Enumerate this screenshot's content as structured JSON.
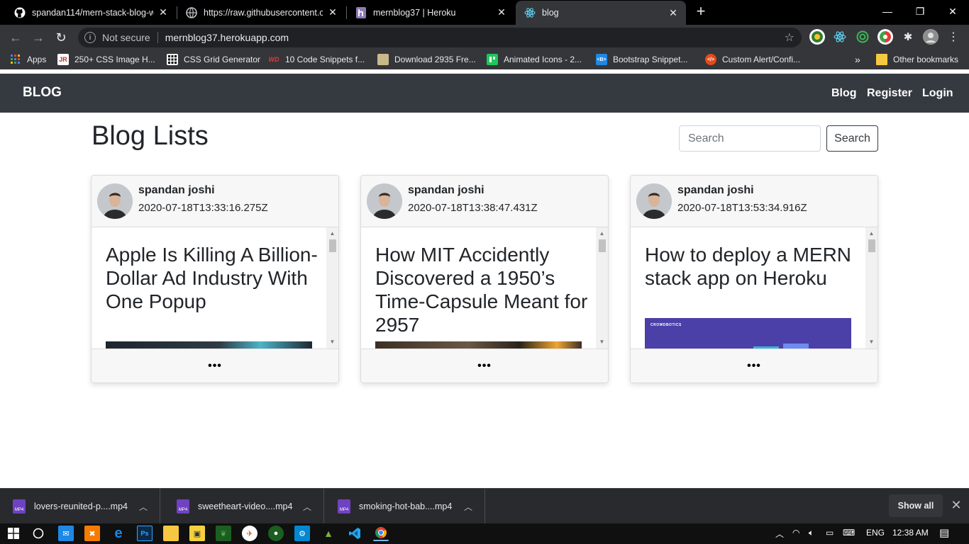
{
  "browser": {
    "tabs": [
      {
        "title": "spandan114/mern-stack-blog-wi",
        "close": "✕",
        "active": false
      },
      {
        "title": "https://raw.githubusercontent.co",
        "close": "✕",
        "active": false
      },
      {
        "title": "mernblog37 | Heroku",
        "close": "✕",
        "active": false
      },
      {
        "title": "blog",
        "close": "✕",
        "active": true
      }
    ],
    "new_tab": "+",
    "window_controls": {
      "minimize": "—",
      "maximize": "❐",
      "close": "✕"
    },
    "toolbar": {
      "back": "←",
      "forward": "→",
      "reload": "↻",
      "security": "Not secure",
      "url": "mernblog37.herokuapp.com",
      "star": "☆"
    },
    "bookmarks": [
      {
        "label": "Apps",
        "icon": "apps-grid-icon"
      },
      {
        "label": "250+ CSS Image H...",
        "icon": "jr-icon",
        "badge": "JR"
      },
      {
        "label": "CSS Grid Generator",
        "icon": "grid-icon"
      },
      {
        "label": "10 Code Snippets f...",
        "icon": "wd-icon",
        "badge": "WD"
      },
      {
        "label": "Download 2935 Fre...",
        "icon": "download-icon"
      },
      {
        "label": "Animated Icons - 2...",
        "icon": "animated-icons-icon"
      },
      {
        "label": "Bootstrap Snippet...",
        "icon": "bootstrap-icon",
        "badge": "<B>"
      },
      {
        "label": "Custom Alert/Confi...",
        "icon": "code-icon",
        "badge": "</>"
      }
    ],
    "bookmarks_more": "»",
    "other_bookmarks": "Other bookmarks"
  },
  "navbar": {
    "brand": "BLOG",
    "links": [
      "Blog",
      "Register",
      "Login"
    ]
  },
  "main": {
    "title": "Blog Lists",
    "search": {
      "placeholder": "Search",
      "button": "Search"
    }
  },
  "posts": [
    {
      "author": "spandan joshi",
      "date": "2020-07-18T13:33:16.275Z",
      "title": "Apple Is Killing A Billion-Dollar Ad Industry With One Popup",
      "more": "•••"
    },
    {
      "author": "spandan joshi",
      "date": "2020-07-18T13:38:47.431Z",
      "title": "How MIT Accidently Discovered a 1950’s Time-Capsule Meant for 2957",
      "more": "•••"
    },
    {
      "author": "spandan joshi",
      "date": "2020-07-18T13:53:34.916Z",
      "title": "How to deploy a MERN stack app on Heroku",
      "image_caption": "CROWDBOTICS",
      "more": "•••"
    }
  ],
  "downloads": {
    "items": [
      {
        "name": "lovers-reunited-p....mp4",
        "icon_label": "MP4"
      },
      {
        "name": "sweetheart-video....mp4",
        "icon_label": "MP4"
      },
      {
        "name": "smoking-hot-bab....mp4",
        "icon_label": "MP4"
      }
    ],
    "show_all": "Show all",
    "close": "✕"
  },
  "taskbar": {
    "language": "ENG",
    "time": "12:38 AM"
  },
  "colors": {
    "navbar": "#343a40",
    "chrome_dark": "#35363a",
    "card_header": "#f7f7f7",
    "bootstrap_dark": "#343a40"
  }
}
